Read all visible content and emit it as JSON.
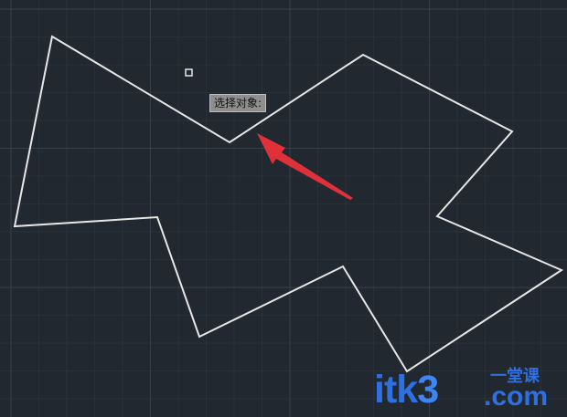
{
  "canvas": {
    "background_color": "#212830",
    "grid_color": "#3a424c",
    "outline_color": "#e6e6e6",
    "arrow_color": "#e0313a"
  },
  "tooltip": {
    "text": "选择对象:"
  },
  "watermark": {
    "brand_part1": "itk",
    "brand_digit": "3",
    "brand_cn": "一堂课",
    "brand_domain": ".com",
    "color": "#2f6fe0"
  }
}
